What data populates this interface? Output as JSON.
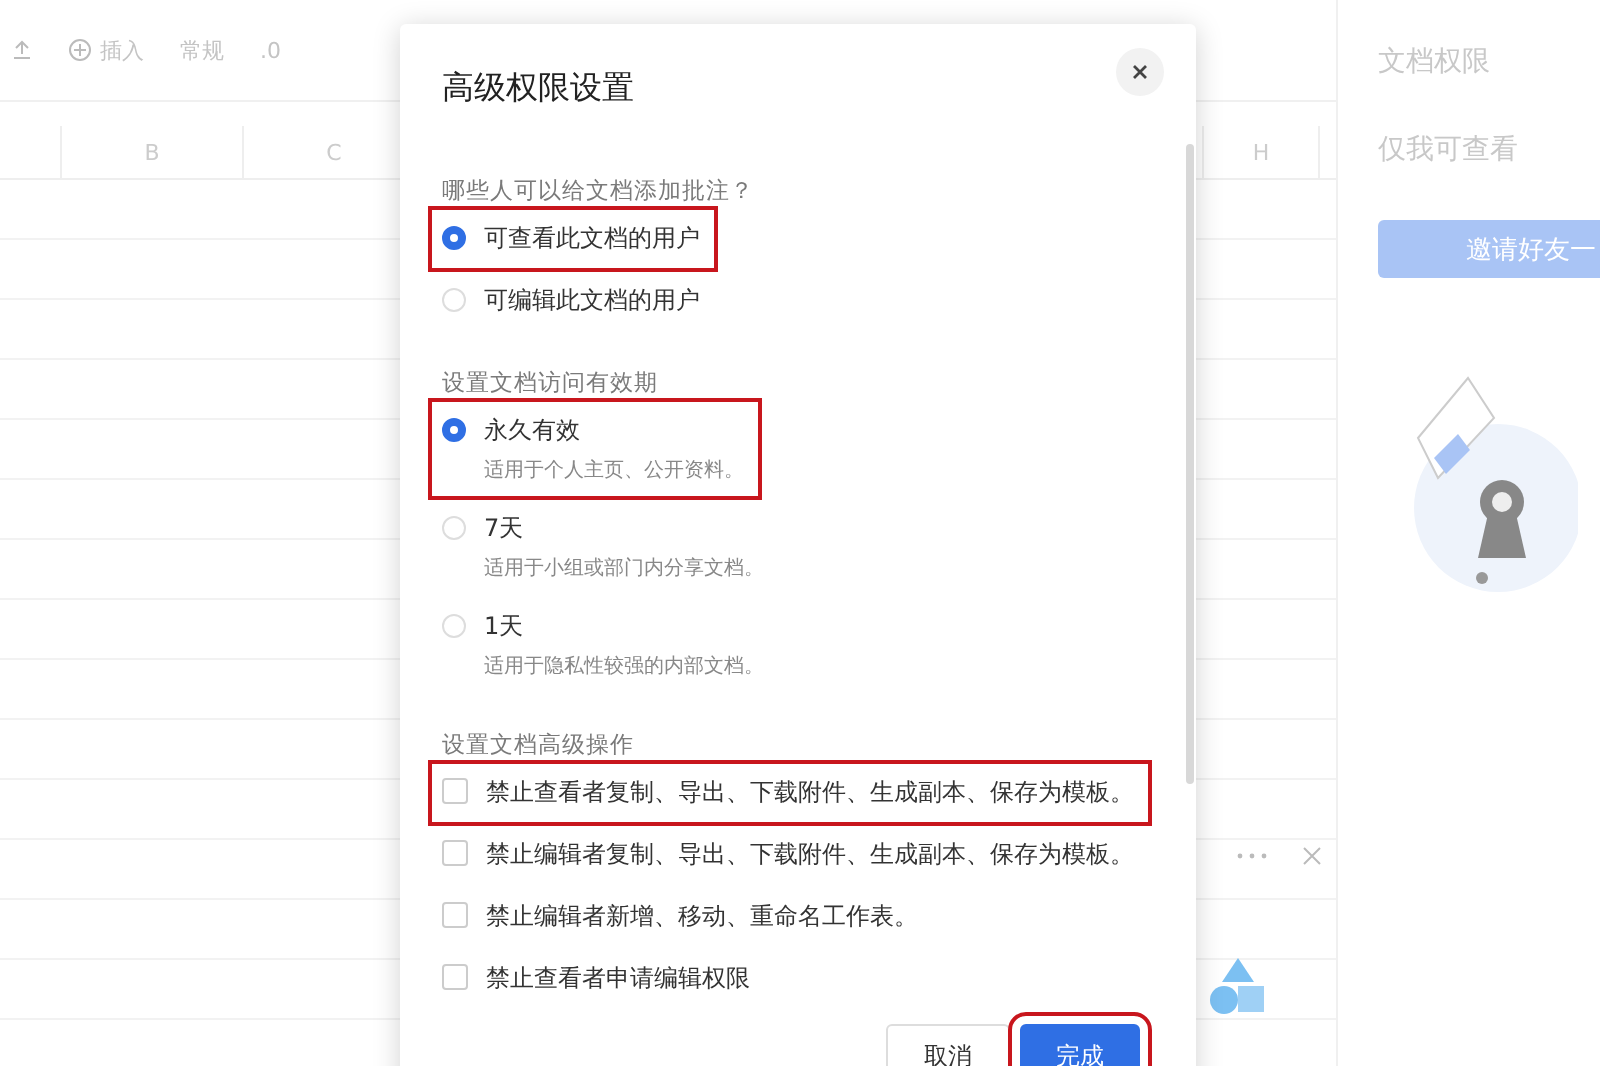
{
  "toolbar": {
    "items": [
      {
        "label": "插入"
      },
      {
        "label": "常规"
      },
      {
        "label": ".0"
      }
    ]
  },
  "sheet": {
    "columns": [
      "B",
      "C",
      "H"
    ]
  },
  "panel": {
    "title": "文档权限",
    "status": "仅我可查看",
    "invite_button": "邀请好友一"
  },
  "dialog": {
    "title": "高级权限设置",
    "sections": [
      {
        "kind": "radio",
        "label": "哪些人可以给文档添加批注？",
        "options": [
          {
            "label": "可查看此文档的用户",
            "selected": true,
            "highlighted": true
          },
          {
            "label": "可编辑此文档的用户",
            "selected": false,
            "highlighted": false
          }
        ]
      },
      {
        "kind": "radio",
        "label": "设置文档访问有效期",
        "options": [
          {
            "label": "永久有效",
            "description": "适用于个人主页、公开资料。",
            "selected": true,
            "highlighted": true
          },
          {
            "label": "7天",
            "description": "适用于小组或部门内分享文档。",
            "selected": false,
            "highlighted": false
          },
          {
            "label": "1天",
            "description": "适用于隐私性较强的内部文档。",
            "selected": false,
            "highlighted": false
          }
        ]
      },
      {
        "kind": "checkbox",
        "label": "设置文档高级操作",
        "options": [
          {
            "label": "禁止查看者复制、导出、下载附件、生成副本、保存为模板。",
            "checked": false,
            "highlighted": true
          },
          {
            "label": "禁止编辑者复制、导出、下载附件、生成副本、保存为模板。",
            "checked": false,
            "highlighted": false
          },
          {
            "label": "禁止编辑者新增、移动、重命名工作表。",
            "checked": false,
            "highlighted": false
          },
          {
            "label": "禁止查看者申请编辑权限",
            "checked": false,
            "highlighted": false
          }
        ]
      }
    ],
    "buttons": [
      {
        "label": "取消",
        "kind": "secondary",
        "highlighted": false
      },
      {
        "label": "完成",
        "kind": "primary",
        "highlighted": true
      }
    ]
  }
}
